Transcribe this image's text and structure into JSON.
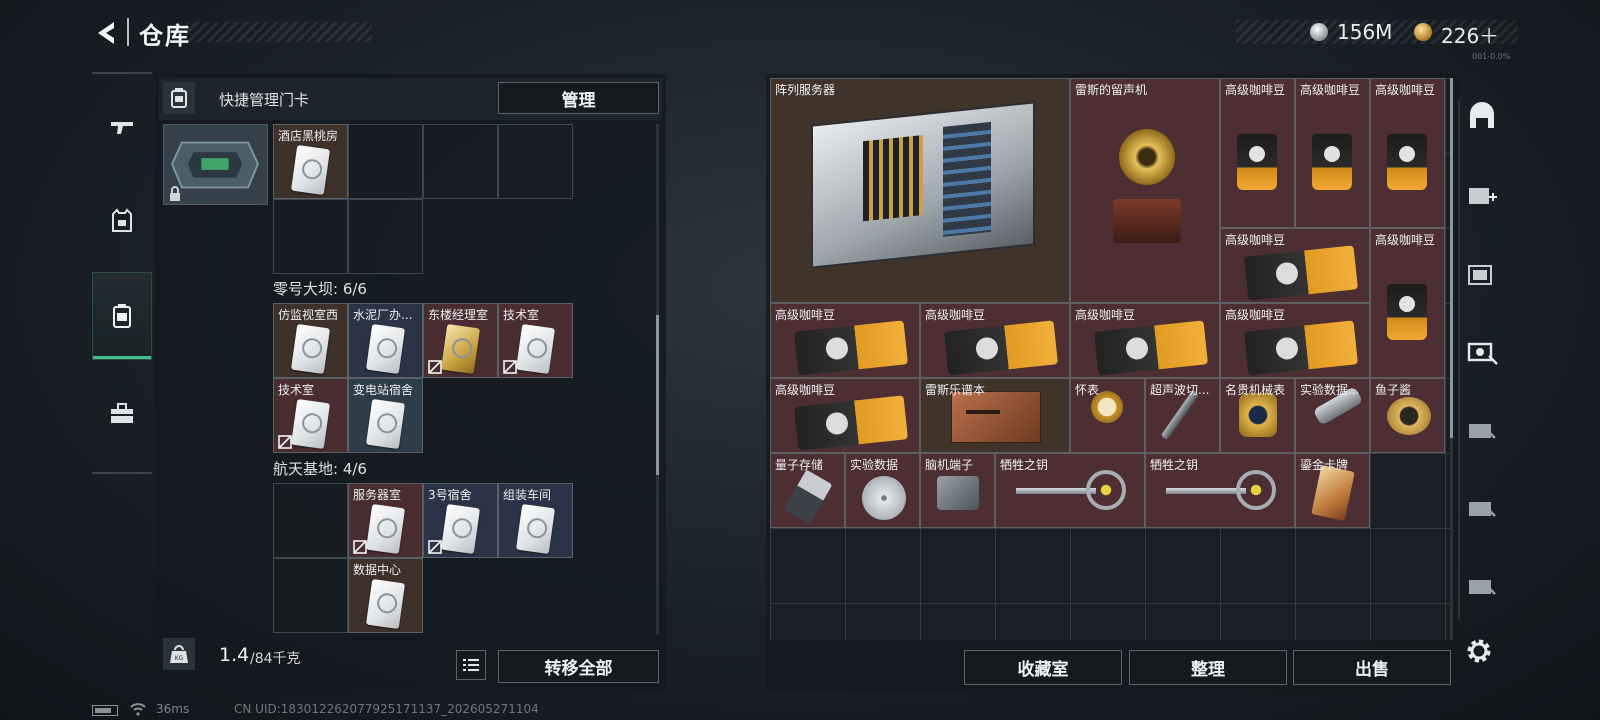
{
  "header": {
    "title": "仓库",
    "silver_value": "156M",
    "gold_value": "226＋",
    "small_tag": "001-0.0%"
  },
  "left_panel": {
    "header_title": "快捷管理门卡",
    "manage_label": "管理",
    "top_group_slots": [
      {
        "label": "酒店黑桃房",
        "color": "brown"
      }
    ],
    "groups": [
      {
        "title": "零号大坝: 6/6",
        "slots": [
          {
            "label": "仿监视室西",
            "color": "brown",
            "no_entry": false
          },
          {
            "label": "水泥厂办...",
            "color": "navy",
            "no_entry": false
          },
          {
            "label": "东楼经理室",
            "color": "red",
            "no_entry": true
          },
          {
            "label": "技术室",
            "color": "red",
            "no_entry": true
          },
          {
            "label": "技术室",
            "color": "red",
            "no_entry": true
          },
          {
            "label": "变电站宿舍",
            "color": "slate",
            "no_entry": false
          }
        ]
      },
      {
        "title": "航天基地: 4/6",
        "slots": [
          {
            "label": "服务器室",
            "color": "red",
            "no_entry": true
          },
          {
            "label": "3号宿舍",
            "color": "navy",
            "no_entry": true
          },
          {
            "label": "组装车间",
            "color": "navy",
            "no_entry": false
          },
          {
            "label": "数据中心",
            "color": "brown",
            "no_entry": false
          }
        ]
      }
    ],
    "weight_current": "1.4",
    "weight_max": "/84千克",
    "transfer_all_label": "转移全部"
  },
  "stash": {
    "items": [
      {
        "label": "阵列服务器"
      },
      {
        "label": "雷斯的留声机"
      },
      {
        "label": "高级咖啡豆"
      },
      {
        "label": "高级咖啡豆"
      },
      {
        "label": "高级咖啡豆"
      },
      {
        "label": "高级咖啡豆"
      },
      {
        "label": "高级咖啡豆"
      },
      {
        "label": "高级咖啡豆"
      },
      {
        "label": "高级咖啡豆"
      },
      {
        "label": "高级咖啡豆"
      },
      {
        "label": "高级咖啡豆"
      },
      {
        "label": "高级咖啡豆"
      },
      {
        "label": "雷斯乐谱本"
      },
      {
        "label": "怀表"
      },
      {
        "label": "超声波切..."
      },
      {
        "label": "名贵机械表"
      },
      {
        "label": "实验数据..."
      },
      {
        "label": "鱼子酱"
      },
      {
        "label": "量子存储"
      },
      {
        "label": "实验数据"
      },
      {
        "label": "脑机端子"
      },
      {
        "label": "牺牲之钥"
      },
      {
        "label": "牺牲之钥"
      },
      {
        "label": "鎏金卡牌"
      }
    ],
    "collection_label": "收藏室",
    "sort_label": "整理",
    "sell_label": "出售"
  },
  "status": {
    "ping": "36ms",
    "uid": "CN UID:183012262077925171137_202605271104"
  },
  "colors": {
    "accent_green": "#3fbf8f",
    "item_red": "#4d2e33",
    "item_brown": "#3f332a"
  },
  "icons": {
    "left_nav": [
      "gun-icon",
      "armor-vest-icon",
      "keycard-case-icon",
      "toolbox-icon"
    ],
    "right_nav": [
      "shelter-icon",
      "medkit-add-icon",
      "ammo-crate-icon",
      "camera-repair-icon",
      "container-a-icon",
      "container-b-icon",
      "container-c-icon"
    ]
  }
}
